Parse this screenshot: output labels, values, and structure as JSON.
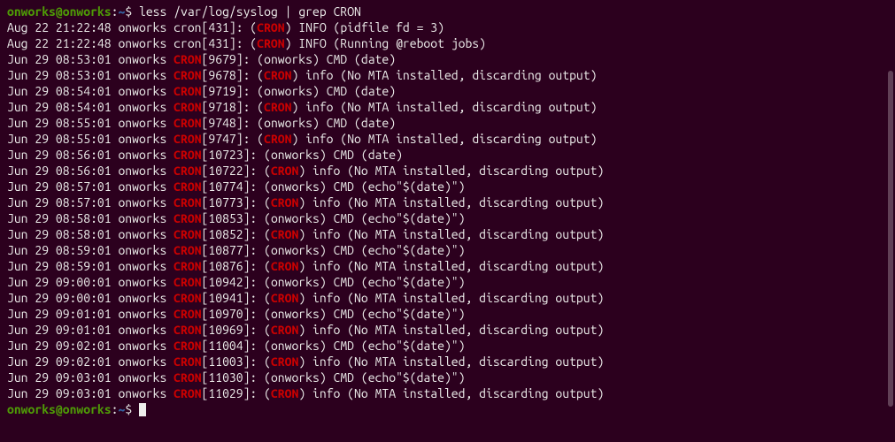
{
  "prompt": {
    "user": "onworks",
    "host": "onworks",
    "path": "~",
    "symbol": "$"
  },
  "command": "less /var/log/syslog | grep CRON",
  "lines": [
    {
      "pre": "Aug 22 21:22:48 onworks cron[431]: (",
      "hl": "CRON",
      "post": ") INFO (pidfile fd = 3)"
    },
    {
      "pre": "Aug 22 21:22:48 onworks cron[431]: (",
      "hl": "CRON",
      "post": ") INFO (Running @reboot jobs)"
    },
    {
      "pre": "Jun 29 08:53:01 onworks ",
      "hl": "CRON",
      "mid": "[9679]: (onworks) CMD (date)"
    },
    {
      "pre": "Jun 29 08:53:01 onworks ",
      "hl": "CRON",
      "mid": "[9678]: (",
      "hl2": "CRON",
      "post": ") info (No MTA installed, discarding output)"
    },
    {
      "pre": "Jun 29 08:54:01 onworks ",
      "hl": "CRON",
      "mid": "[9719]: (onworks) CMD (date)"
    },
    {
      "pre": "Jun 29 08:54:01 onworks ",
      "hl": "CRON",
      "mid": "[9718]: (",
      "hl2": "CRON",
      "post": ") info (No MTA installed, discarding output)"
    },
    {
      "pre": "Jun 29 08:55:01 onworks ",
      "hl": "CRON",
      "mid": "[9748]: (onworks) CMD (date)"
    },
    {
      "pre": "Jun 29 08:55:01 onworks ",
      "hl": "CRON",
      "mid": "[9747]: (",
      "hl2": "CRON",
      "post": ") info (No MTA installed, discarding output)"
    },
    {
      "pre": "Jun 29 08:56:01 onworks ",
      "hl": "CRON",
      "mid": "[10723]: (onworks) CMD (date)"
    },
    {
      "pre": "Jun 29 08:56:01 onworks ",
      "hl": "CRON",
      "mid": "[10722]: (",
      "hl2": "CRON",
      "post": ") info (No MTA installed, discarding output)"
    },
    {
      "pre": "Jun 29 08:57:01 onworks ",
      "hl": "CRON",
      "mid": "[10774]: (onworks) CMD (echo\"$(date)\")"
    },
    {
      "pre": "Jun 29 08:57:01 onworks ",
      "hl": "CRON",
      "mid": "[10773]: (",
      "hl2": "CRON",
      "post": ") info (No MTA installed, discarding output)"
    },
    {
      "pre": "Jun 29 08:58:01 onworks ",
      "hl": "CRON",
      "mid": "[10853]: (onworks) CMD (echo\"$(date)\")"
    },
    {
      "pre": "Jun 29 08:58:01 onworks ",
      "hl": "CRON",
      "mid": "[10852]: (",
      "hl2": "CRON",
      "post": ") info (No MTA installed, discarding output)"
    },
    {
      "pre": "Jun 29 08:59:01 onworks ",
      "hl": "CRON",
      "mid": "[10877]: (onworks) CMD (echo\"$(date)\")"
    },
    {
      "pre": "Jun 29 08:59:01 onworks ",
      "hl": "CRON",
      "mid": "[10876]: (",
      "hl2": "CRON",
      "post": ") info (No MTA installed, discarding output)"
    },
    {
      "pre": "Jun 29 09:00:01 onworks ",
      "hl": "CRON",
      "mid": "[10942]: (onworks) CMD (echo\"$(date)\")"
    },
    {
      "pre": "Jun 29 09:00:01 onworks ",
      "hl": "CRON",
      "mid": "[10941]: (",
      "hl2": "CRON",
      "post": ") info (No MTA installed, discarding output)"
    },
    {
      "pre": "Jun 29 09:01:01 onworks ",
      "hl": "CRON",
      "mid": "[10970]: (onworks) CMD (echo\"$(date)\")"
    },
    {
      "pre": "Jun 29 09:01:01 onworks ",
      "hl": "CRON",
      "mid": "[10969]: (",
      "hl2": "CRON",
      "post": ") info (No MTA installed, discarding output)"
    },
    {
      "pre": "Jun 29 09:02:01 onworks ",
      "hl": "CRON",
      "mid": "[11004]: (onworks) CMD (echo\"$(date)\")"
    },
    {
      "pre": "Jun 29 09:02:01 onworks ",
      "hl": "CRON",
      "mid": "[11003]: (",
      "hl2": "CRON",
      "post": ") info (No MTA installed, discarding output)"
    },
    {
      "pre": "Jun 29 09:03:01 onworks ",
      "hl": "CRON",
      "mid": "[11030]: (onworks) CMD (echo\"$(date)\")"
    },
    {
      "pre": "Jun 29 09:03:01 onworks ",
      "hl": "CRON",
      "mid": "[11029]: (",
      "hl2": "CRON",
      "post": ") info (No MTA installed, discarding output)"
    }
  ]
}
